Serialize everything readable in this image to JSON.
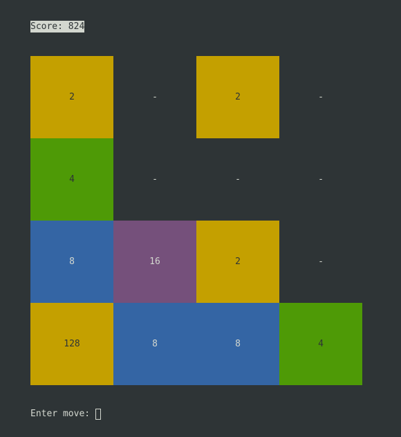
{
  "score": {
    "label": "Score:",
    "value": "824"
  },
  "colors": {
    "background": "#2e3436",
    "text": "#d3d7cf",
    "tile_dark_text": "#2e3436",
    "tile_2": "#c4a000",
    "tile_4": "#4e9a06",
    "tile_8": "#3465a4",
    "tile_16": "#75507b",
    "tile_128": "#c4a000"
  },
  "board": {
    "rows": [
      [
        "2",
        "-",
        "2",
        "-"
      ],
      [
        "4",
        "-",
        "-",
        "-"
      ],
      [
        "8",
        "16",
        "2",
        "-"
      ],
      [
        "128",
        "8",
        "8",
        "4"
      ]
    ]
  },
  "prompt": {
    "label": "Enter move:"
  }
}
